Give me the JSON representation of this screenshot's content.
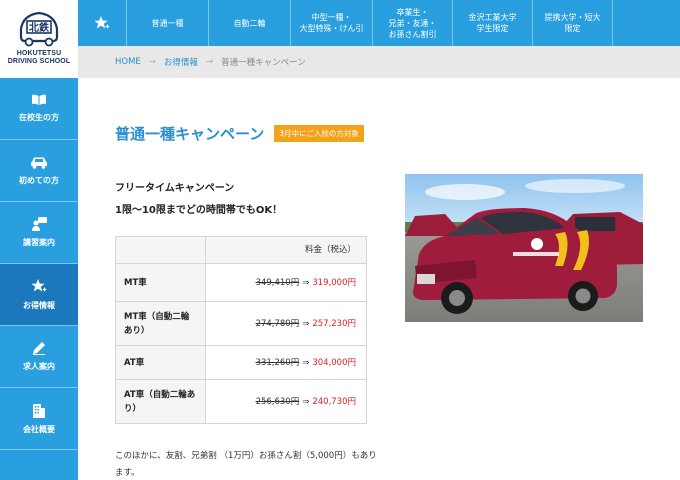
{
  "logo": {
    "line1": "HOKUTETSU",
    "line2": "DRIVING SCHOOL"
  },
  "topnav": {
    "items": [
      {
        "label": "普通一種"
      },
      {
        "label": "自動二輪"
      },
      {
        "label": "中型一種・\n大型特殊・けん引"
      },
      {
        "label": "卒業生・\n兄弟・友達・\nお孫さん割引"
      },
      {
        "label": "金沢工業大学\n学生限定"
      },
      {
        "label": "提携大学・短大\n限定"
      }
    ]
  },
  "breadcrumb": {
    "home": "HOME",
    "level2": "お得情報",
    "current": "普通一種キャンペーン",
    "separator": "→"
  },
  "sidebar": {
    "items": [
      {
        "label": "在校生の方",
        "icon": "book-icon"
      },
      {
        "label": "初めての方",
        "icon": "car-icon"
      },
      {
        "label": "講習案内",
        "icon": "speech-person-icon"
      },
      {
        "label": "お得情報",
        "icon": "star-icon"
      },
      {
        "label": "求人案内",
        "icon": "pen-icon"
      },
      {
        "label": "会社概要",
        "icon": "building-icon"
      }
    ]
  },
  "main": {
    "title": "普通一種キャンペーン",
    "badge": "3月中にご入校の方対象",
    "lead1": "フリータイムキャンペーン",
    "lead2": "1限～10限までどの時間帯でもOK！",
    "table": {
      "header": "料金（税込）",
      "rows": [
        {
          "name": "MT車",
          "old": "349,410円",
          "new": "319,000円"
        },
        {
          "name": "MT車（自動二輪あり）",
          "old": "274,780円",
          "new": "257,230円"
        },
        {
          "name": "AT車",
          "old": "331,260円",
          "new": "304,000円"
        },
        {
          "name": "AT車（自動二輪あり）",
          "old": "256,630円",
          "new": "240,730円"
        }
      ],
      "arrow": "⇒"
    },
    "note": "このほかに、友割、兄弟割 （1万円）お孫さん割（5,000円）もあります。"
  },
  "colors": {
    "primary": "#2a9fe0",
    "active": "#1c78bd",
    "badge": "#f3a21a",
    "sale": "#e02020"
  }
}
